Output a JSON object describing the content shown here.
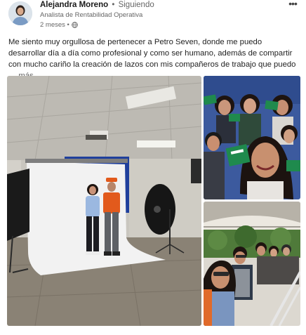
{
  "post": {
    "author": {
      "name": "Alejandra Moreno",
      "separator": "•",
      "follow_status": "Siguiendo",
      "headline": "Analista de Rentabilidad Operativa",
      "time": "2 meses •"
    },
    "more_menu_icon": "ellipsis-icon",
    "visibility_icon": "globe-icon",
    "text": "Me siento muy orgullosa de pertenecer a Petro Seven, donde me puedo desarrollar día a día como profesional y como ser humano, además de compartir con mucho cariño la creación de lazos con mis compañeros de trabajo que puedo",
    "see_more": "… más"
  },
  "photos": {
    "main": {
      "description": "studio-photoshoot",
      "sign_text": ""
    },
    "top_right": {
      "description": "group-selfie-with-signs"
    },
    "bottom_right": {
      "description": "group-on-bus"
    }
  },
  "colors": {
    "text": "#1f1f1f",
    "muted": "#666666",
    "studio_blue": "#1f3f9c",
    "uniform_orange": "#e25a1c"
  }
}
